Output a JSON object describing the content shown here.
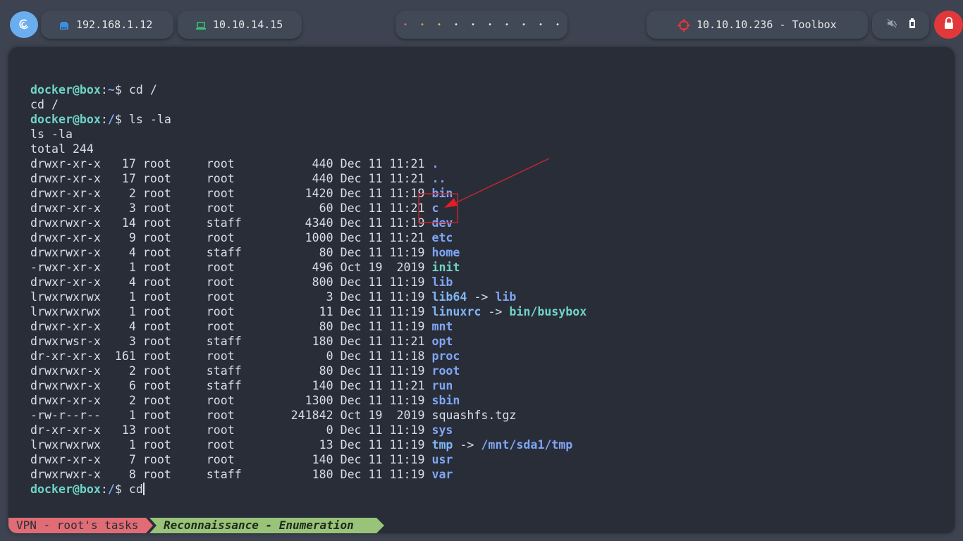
{
  "topbar": {
    "ip_label": "192.168.1.12",
    "vpn_label": "10.10.14.15",
    "workspaces": [
      "•",
      "•",
      "•",
      "•",
      "•",
      "•",
      "•",
      "•",
      "•",
      "•"
    ],
    "workspace_colors": [
      "#e06c75",
      "#e5a43c",
      "#e5c07b",
      "#e6e6e6",
      "#e6e6e6",
      "#e6e6e6",
      "#e6e6e6",
      "#e6e6e6",
      "#e6e6e6",
      "#e6e6e6"
    ],
    "target_label": "10.10.10.236 - Toolbox",
    "icons": {
      "os": "debian-logo-icon",
      "ip": "ethernet-icon",
      "vpn": "laptop-icon",
      "target": "crosshair-icon",
      "mute": "speaker-muted-icon",
      "battery": "battery-icon",
      "lock": "lock-icon"
    },
    "colors": {
      "accent": "#6aaef0",
      "lock": "#e0383b",
      "target_icon": "#e0383b",
      "vpn_icon": "#38c172"
    }
  },
  "terminal": {
    "prompt_user": "docker@box",
    "lines": [
      {
        "type": "prompt",
        "path": "~",
        "cmd": "cd /"
      },
      {
        "type": "out",
        "text": "cd /"
      },
      {
        "type": "prompt",
        "path": "/",
        "cmd": "ls -la"
      },
      {
        "type": "out",
        "text": "ls -la"
      },
      {
        "type": "out",
        "text": "total 244"
      }
    ],
    "listing": [
      {
        "meta": "drwxr-xr-x   17 root     root           440 Dec 11 11:21 ",
        "name": ".",
        "kind": "dir"
      },
      {
        "meta": "drwxr-xr-x   17 root     root           440 Dec 11 11:21 ",
        "name": "..",
        "kind": "dir"
      },
      {
        "meta": "drwxr-xr-x    2 root     root          1420 Dec 11 11:19 ",
        "name": "bin",
        "kind": "dir"
      },
      {
        "meta": "drwxr-xr-x    3 root     root            60 Dec 11 11:21 ",
        "name": "c",
        "kind": "dir"
      },
      {
        "meta": "drwxrwxr-x   14 root     staff         4340 Dec 11 11:19 ",
        "name": "dev",
        "kind": "dir"
      },
      {
        "meta": "drwxr-xr-x    9 root     root          1000 Dec 11 11:21 ",
        "name": "etc",
        "kind": "dir"
      },
      {
        "meta": "drwxrwxr-x    4 root     staff           80 Dec 11 11:19 ",
        "name": "home",
        "kind": "dir"
      },
      {
        "meta": "-rwxr-xr-x    1 root     root           496 Oct 19  2019 ",
        "name": "init",
        "kind": "exe"
      },
      {
        "meta": "drwxr-xr-x    4 root     root           800 Dec 11 11:19 ",
        "name": "lib",
        "kind": "dir"
      },
      {
        "meta": "lrwxrwxrwx    1 root     root             3 Dec 11 11:19 ",
        "name": "lib64",
        "kind": "lnk",
        "arrow": " -> ",
        "target": "lib",
        "target_kind": "dir"
      },
      {
        "meta": "lrwxrwxrwx    1 root     root            11 Dec 11 11:19 ",
        "name": "linuxrc",
        "kind": "lnk",
        "arrow": " -> ",
        "target": "bin/busybox",
        "target_kind": "exe"
      },
      {
        "meta": "drwxr-xr-x    4 root     root            80 Dec 11 11:19 ",
        "name": "mnt",
        "kind": "dir"
      },
      {
        "meta": "drwxrwsr-x    3 root     staff          180 Dec 11 11:21 ",
        "name": "opt",
        "kind": "dir"
      },
      {
        "meta": "dr-xr-xr-x  161 root     root             0 Dec 11 11:18 ",
        "name": "proc",
        "kind": "dir"
      },
      {
        "meta": "drwxrwxr-x    2 root     staff           80 Dec 11 11:19 ",
        "name": "root",
        "kind": "dir"
      },
      {
        "meta": "drwxrwxr-x    6 root     staff          140 Dec 11 11:21 ",
        "name": "run",
        "kind": "dir"
      },
      {
        "meta": "drwxr-xr-x    2 root     root          1300 Dec 11 11:19 ",
        "name": "sbin",
        "kind": "dir"
      },
      {
        "meta": "-rw-r--r--    1 root     root        241842 Oct 19  2019 ",
        "name": "squashfs.tgz",
        "kind": "plain"
      },
      {
        "meta": "dr-xr-xr-x   13 root     root             0 Dec 11 11:19 ",
        "name": "sys",
        "kind": "dir"
      },
      {
        "meta": "lrwxrwxrwx    1 root     root            13 Dec 11 11:19 ",
        "name": "tmp",
        "kind": "lnk",
        "arrow": " -> ",
        "target": "/mnt/sda1/tmp",
        "target_kind": "dir"
      },
      {
        "meta": "drwxr-xr-x    7 root     root           140 Dec 11 11:19 ",
        "name": "usr",
        "kind": "dir"
      },
      {
        "meta": "drwxrwxr-x    8 root     staff          180 Dec 11 11:19 ",
        "name": "var",
        "kind": "dir"
      }
    ],
    "final_prompt": {
      "path": "/",
      "cmd": "cd"
    }
  },
  "statusbar": {
    "vpn_segment": "VPN - root's tasks",
    "task_segment": "Reconnaissance - Enumeration"
  }
}
